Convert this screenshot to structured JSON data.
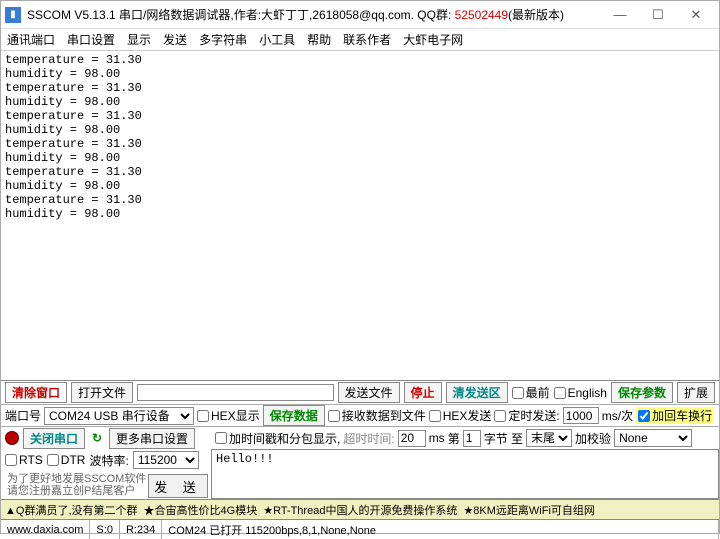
{
  "title": {
    "prefix": "SSCOM V5.13.1 串口/网络数据调试器,作者:大虾丁丁,2618058@qq.com. QQ群: ",
    "qq": "52502449",
    "suffix": "(最新版本)"
  },
  "menu": [
    "通讯端口",
    "串口设置",
    "显示",
    "发送",
    "多字符串",
    "小工具",
    "帮助",
    "联系作者",
    "大虾电子网"
  ],
  "terminal": "temperature = 31.30\nhumidity = 98.00\ntemperature = 31.30\nhumidity = 98.00\ntemperature = 31.30\nhumidity = 98.00\ntemperature = 31.30\nhumidity = 98.00\ntemperature = 31.30\nhumidity = 98.00\ntemperature = 31.30\nhumidity = 98.00",
  "tb1": {
    "clear": "清除窗口",
    "open": "打开文件",
    "sendfile": "发送文件",
    "stop": "停止",
    "clearsend": "清发送区",
    "top": "最前",
    "english": "English",
    "saveparam": "保存参数",
    "expand": "扩展"
  },
  "row2": {
    "portlbl": "端口号",
    "portval": "COM24 USB 串行设备",
    "hexdisp": "HEX显示",
    "savedata": "保存数据",
    "recvfile": "接收数据到文件",
    "hexsend": "HEX发送",
    "timersend": "定时发送:",
    "interval": "1000",
    "intervalunit": "ms/次",
    "addcrlf": "加回车换行"
  },
  "row3": {
    "close": "关闭串口",
    "moreport": "更多串口设置",
    "tsshow": "加时间戳和分包显示,",
    "timeout": "超时时间:",
    "timeoutval": "20",
    "ms": "ms",
    "no": "第",
    "noval": "1",
    "byte": "字节 至",
    "end": "末尾",
    "addchk": "加校验",
    "chkval": "None"
  },
  "row4": {
    "rts": "RTS",
    "dtr": "DTR",
    "baudlbl": "波特率:",
    "baud": "115200",
    "hint1": "为了更好地发展SSCOM软件",
    "hint2": "请您注册嘉立创P结尾客户",
    "send": "发 送",
    "input": "Hello!!!"
  },
  "footer1": {
    "a": "Q群满员了,没有第二个群",
    "b": "★合宙高性价比4G模块",
    "c": "★RT-Thread中国人的开源免费操作系统",
    "d": "★8KM远距离WiFi可自组网"
  },
  "footer2": {
    "url": "www.daxia.com",
    "s": "S:0",
    "r": "R:234",
    "status": "COM24 已打开 115200bps,8,1,None,None"
  }
}
